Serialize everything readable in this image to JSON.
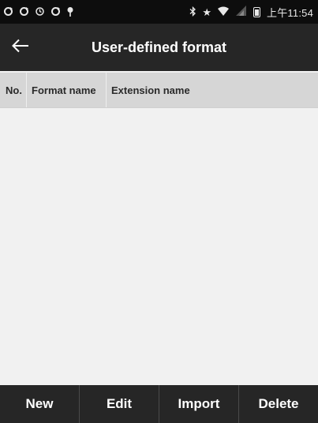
{
  "status_bar": {
    "left_icons": [
      "sync-icon",
      "sync-icon",
      "sync-icon",
      "sync-icon",
      "pin-icon"
    ],
    "right_icons": [
      "bluetooth-icon",
      "star-icon",
      "wifi-icon",
      "signal-icon",
      "battery-icon"
    ],
    "time": "上午11:54"
  },
  "header": {
    "title": "User-defined format",
    "back_icon": "arrow-left-icon"
  },
  "table": {
    "columns": [
      "No.",
      "Format name",
      "Extension name"
    ],
    "rows": []
  },
  "bottom_bar": {
    "new_label": "New",
    "edit_label": "Edit",
    "import_label": "Import",
    "delete_label": "Delete"
  },
  "colors": {
    "status_bar_bg": "#0d0d0d",
    "title_bar_bg": "#262626",
    "table_header_bg": "#d6d6d6",
    "content_bg": "#f1f1f1",
    "bottom_bar_bg": "#262626"
  }
}
